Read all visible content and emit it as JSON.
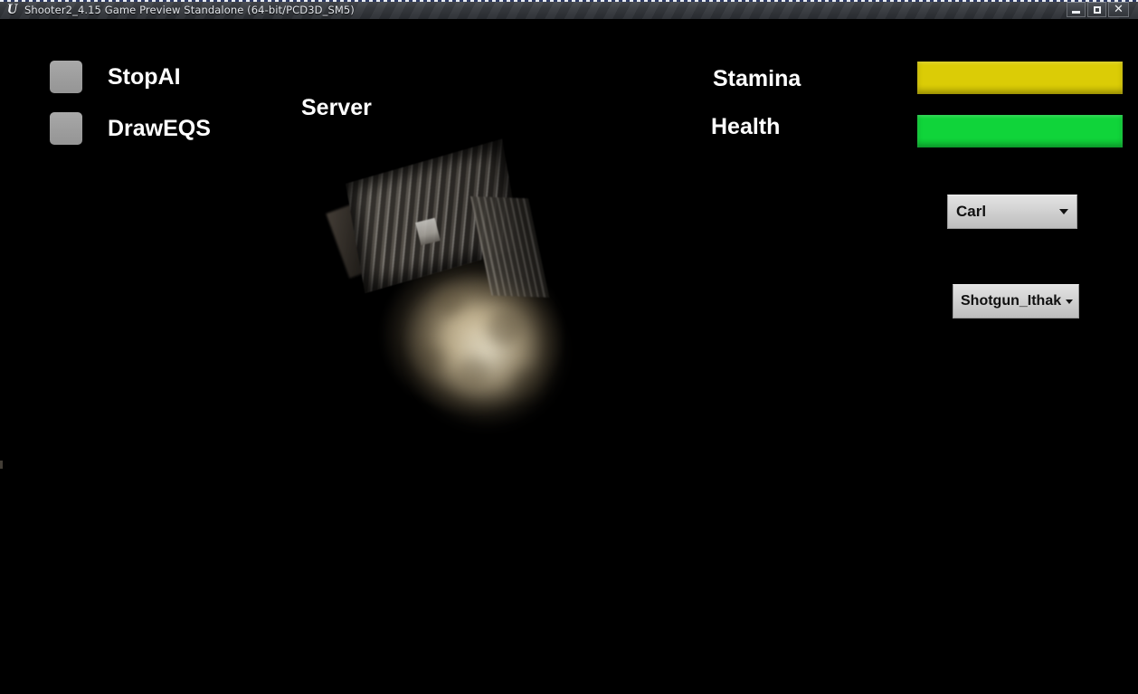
{
  "window": {
    "title": "Shooter2_4.15 Game Preview Standalone (64-bit/PCD3D_SM5)",
    "logo_glyph": "U",
    "controls": {
      "minimize_label": "Minimize",
      "restore_label": "Restore",
      "close_label": "✕"
    }
  },
  "hud": {
    "checkboxes": [
      {
        "label": "StopAI",
        "checked": false
      },
      {
        "label": "DrawEQS",
        "checked": false
      }
    ],
    "network_role_label": "Server",
    "stats": [
      {
        "label": "Stamina",
        "value_percent": 100,
        "color": "#dbcc06"
      },
      {
        "label": "Health",
        "value_percent": 100,
        "color": "#10d43a"
      }
    ],
    "dropdowns": [
      {
        "name": "character-select",
        "selected": "Carl",
        "arrow_glyph": "▾"
      },
      {
        "name": "weapon-select",
        "selected": "Shotgun_Ithak",
        "arrow_glyph": "▾"
      }
    ]
  }
}
